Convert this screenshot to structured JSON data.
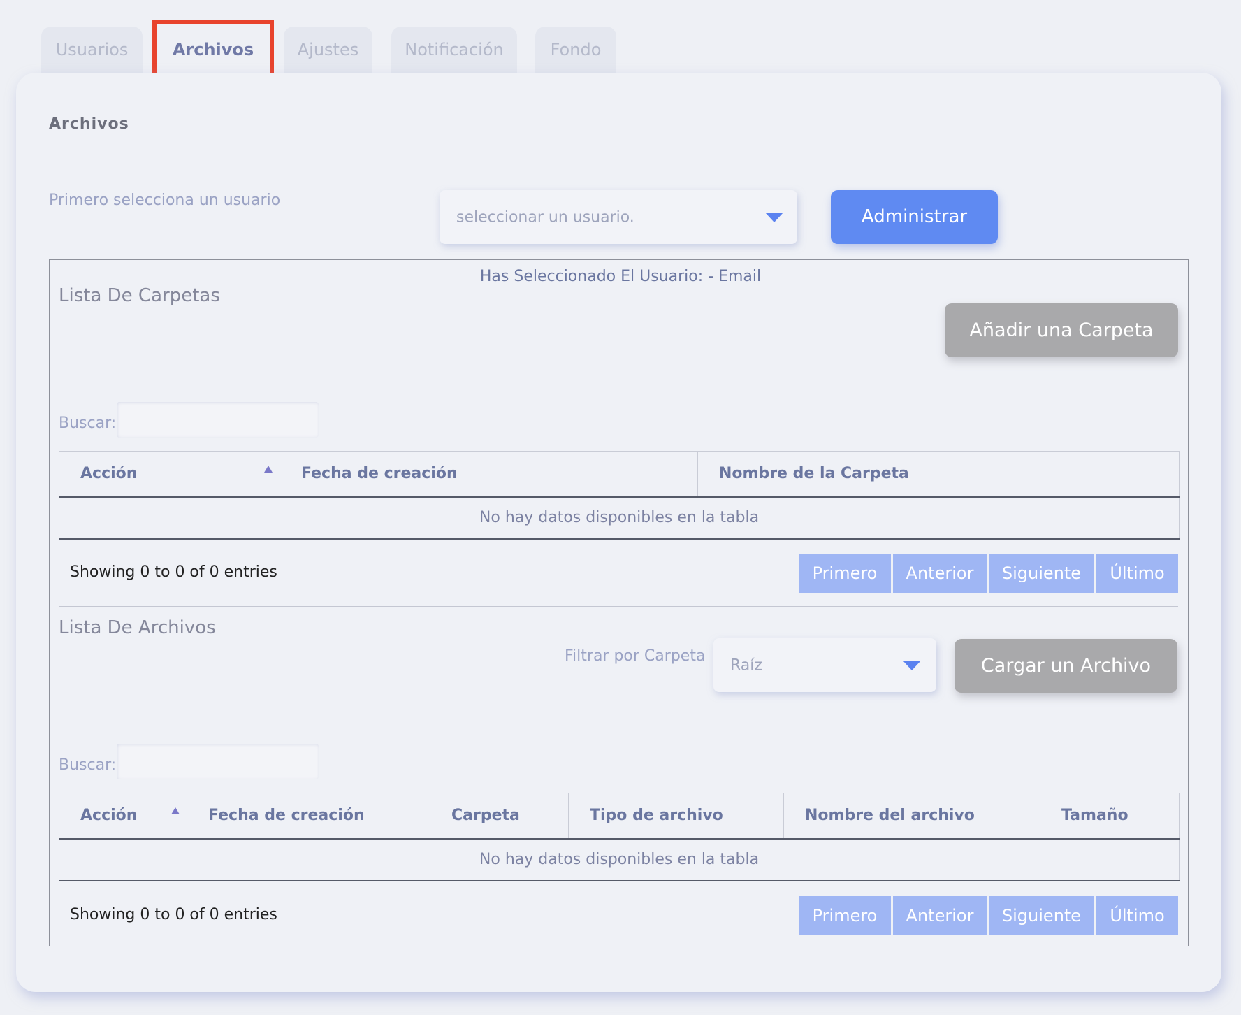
{
  "tabs": [
    {
      "label": "Usuarios"
    },
    {
      "label": "Archivos",
      "active": true
    },
    {
      "label": "Ajustes"
    },
    {
      "label": "Notificación"
    },
    {
      "label": "Fondo"
    }
  ],
  "section_title": "Archivos",
  "user_select": {
    "hint": "Primero selecciona un usuario",
    "placeholder": "seleccionar un usuario."
  },
  "manage_button": "Administrar",
  "selected_user_text": "Has Seleccionado El Usuario: - Email",
  "folders": {
    "title": "Lista De Carpetas",
    "add_button": "Añadir una Carpeta",
    "search_label": "Buscar:",
    "columns": [
      "Acción",
      "Fecha de creación",
      "Nombre de la Carpeta"
    ],
    "empty_text": "No hay datos disponibles en la tabla",
    "info": "Showing 0 to 0 of 0 entries",
    "pager": [
      "Primero",
      "Anterior",
      "Siguiente",
      "Último"
    ]
  },
  "files": {
    "title": "Lista De Archivos",
    "filter_label": "Filtrar por Carpeta",
    "filter_value": "Raíz",
    "upload_button": "Cargar un Archivo",
    "search_label": "Buscar:",
    "columns": [
      "Acción",
      "Fecha de creación",
      "Carpeta",
      "Tipo de archivo",
      "Nombre del archivo",
      "Tamaño"
    ],
    "empty_text": "No hay datos disponibles en la tabla",
    "info": "Showing 0 to 0 of 0 entries",
    "pager": [
      "Primero",
      "Anterior",
      "Siguiente",
      "Último"
    ]
  },
  "colors": {
    "accent": "#5f8af2",
    "pager": "#9fb6f4",
    "highlight": "#e8432d",
    "secondary_button": "#a9a9ab"
  },
  "icons": [
    "chevron-down-icon",
    "sort-ascending-icon"
  ]
}
